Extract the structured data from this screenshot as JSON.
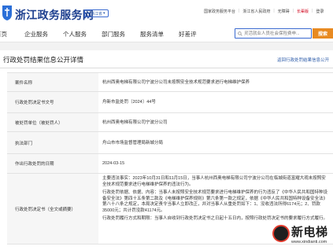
{
  "header": {
    "brand_small": "国家政务服务平台 | 浙江省人民政府 | 国家宪法 | 阁的宪法",
    "brand_main": "浙江政务服务网",
    "region": "浙江省",
    "top_links": [
      {
        "label": "国家政务服务平台",
        "style": "normal"
      },
      {
        "label": "浙江省人民政府",
        "style": "normal"
      },
      {
        "label": "无障碍",
        "style": "normal"
      },
      {
        "label": "长辈版",
        "style": "elder"
      },
      {
        "label": "登录",
        "style": "normal"
      }
    ]
  },
  "nav": {
    "items": [
      "首页",
      "企业服务",
      "个人服务",
      "部门服务",
      "服务清单",
      "好差评"
    ],
    "search_placeholder": "灵活就业人员社会保险费申...",
    "search_button": "搜索"
  },
  "page": {
    "title": "行政处罚结果信息公开详情",
    "return_link": "返回行政处罚结果信息公开"
  },
  "table": {
    "rows": [
      {
        "label": "案件名称",
        "value": "杭州西奥电梯有限公司宁波分公司未按照安全技术规范要求进行电梯维护保养"
      },
      {
        "label": "行政处罚决定书文号",
        "value": "舟新市监处罚〔2024〕44号"
      },
      {
        "label": "被处罚单位（被处罚人）",
        "value": "杭州西奥电梯有限公司宁波分公司"
      },
      {
        "label": "执法部门",
        "value": "舟山市市场监督管理局新城分局"
      },
      {
        "label": "作出行政处罚的日期",
        "value": "2024-03-15"
      },
      {
        "label": "行政处罚决定书（全文或摘要）",
        "paragraphs": [
          "主要违法事实：2023年10月31日和11月15日，当事人杭州西奥电梯有限公司宁波分公司在临城街道富耀大观未按照安全技术规范要求进行电梯维护保养的违法行为。",
          "行政处罚依据、依据、内容：当事人未按照安全技术规范要求进行电梯维护保养的行为违反了《中华人民共和国特种设备安全法》第四十五条第二款及《电梯维护保养规则》第六条第一款之规定，依据《中华人民共和国特种设备安全法》第八十八条之规定，本局决定责令当事人立即改正，并对当事人从重处罚如下：1、没收违法所得6174元；2、罚款35000元；共计罚没款41174元。",
          "行政处罚履行方式和期限：当事人自收到行政处罚决定书之日起十五日内，按照行政处罚决定书的要求履行方式履行。"
        ]
      }
    ]
  },
  "watermark": {
    "text": "新电梯",
    "url": "www.xindianti.com"
  },
  "colors": {
    "brand_blue": "#1d3f8f",
    "accent_orange": "#e88a21",
    "elder_red": "#d0021b",
    "link_blue": "#2b5aa8"
  }
}
